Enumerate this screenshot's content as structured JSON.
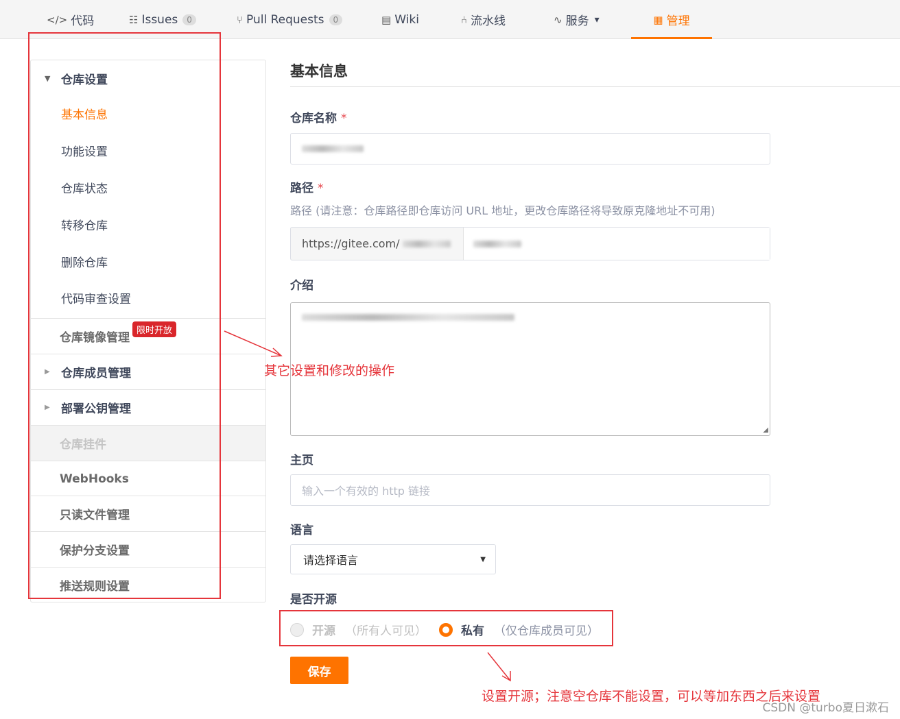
{
  "nav": {
    "tabs": [
      {
        "icon": "</>",
        "label": "代码"
      },
      {
        "icon": "☷",
        "label": "Issues",
        "count": "0"
      },
      {
        "icon": "⑂",
        "label": "Pull Requests",
        "count": "0"
      },
      {
        "icon": "▤",
        "label": "Wiki"
      },
      {
        "icon": "⑃",
        "label": "流水线"
      },
      {
        "icon": "∿",
        "label": "服务"
      },
      {
        "icon": "▦",
        "label": "管理"
      }
    ],
    "service_dropdown": "▾"
  },
  "sidebar": {
    "group_title": "仓库设置",
    "sub_items": [
      "基本信息",
      "功能设置",
      "仓库状态",
      "转移仓库",
      "删除仓库",
      "代码审查设置"
    ],
    "rows": [
      {
        "label": "仓库镜像管理",
        "badge": "限时开放"
      },
      {
        "label": "仓库成员管理"
      },
      {
        "label": "部署公钥管理"
      },
      {
        "label": "仓库挂件"
      },
      {
        "label": "WebHooks"
      },
      {
        "label": "只读文件管理"
      },
      {
        "label": "保护分支设置"
      },
      {
        "label": "推送规则设置"
      }
    ]
  },
  "form": {
    "title": "基本信息",
    "name_label": "仓库名称",
    "required_mark": "*",
    "path_label": "路径",
    "path_hint": "路径 (请注意：仓库路径即仓库访问 URL 地址，更改仓库路径将导致原克隆地址不可用)",
    "path_prefix": "https://gitee.com/",
    "intro_label": "介绍",
    "homepage_label": "主页",
    "homepage_placeholder": "输入一个有效的 http 链接",
    "language_label": "语言",
    "language_value": "请选择语言",
    "open_label": "是否开源",
    "open_option": "开源",
    "open_desc": "（所有人可见）",
    "private_option": "私有",
    "private_desc": "（仅仓库成员可见）",
    "save_label": "保存"
  },
  "annotations": {
    "sidebar_note": "其它设置和修改的操作",
    "radio_note": "设置开源；注意空仓库不能设置，可以等加东西之后来设置"
  },
  "watermark": "CSDN @turbo夏日漱石",
  "colors": {
    "accent": "#fe7300",
    "annotation": "#e5353b",
    "badge": "#d9262b"
  }
}
